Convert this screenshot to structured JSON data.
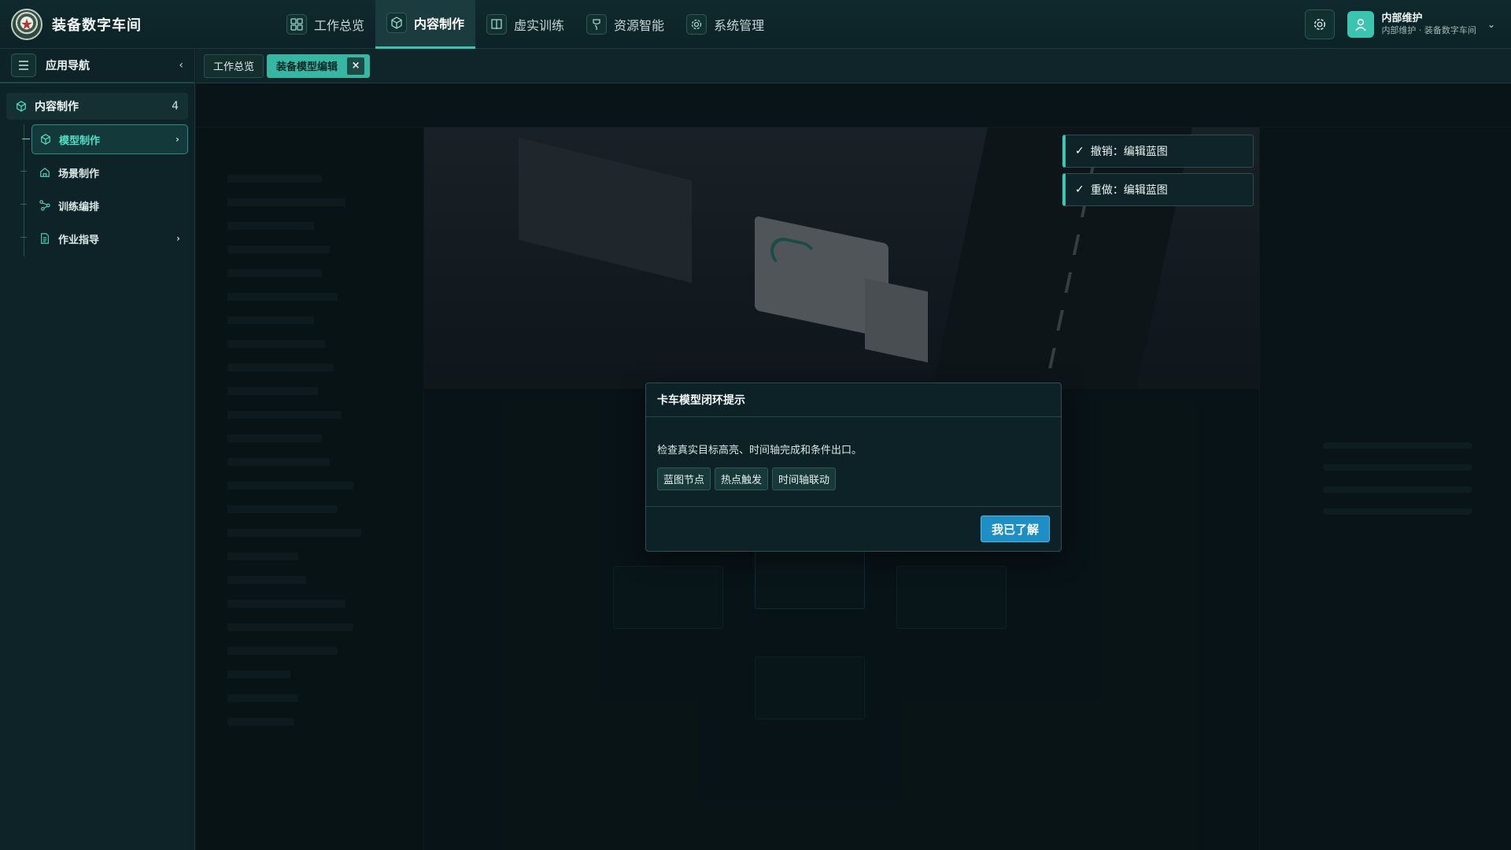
{
  "app": {
    "title": "装备数字车间"
  },
  "nav": [
    {
      "label": "工作总览",
      "icon": "dashboard-grid-icon"
    },
    {
      "label": "内容制作",
      "icon": "cube-icon",
      "active": true
    },
    {
      "label": "虚实训练",
      "icon": "book-icon"
    },
    {
      "label": "资源智能",
      "icon": "plug-icon"
    },
    {
      "label": "系统管理",
      "icon": "gear-icon"
    }
  ],
  "user": {
    "name": "内部维护",
    "sub": "内部维护 · 装备数字车间"
  },
  "sidebar": {
    "title": "应用导航",
    "group": {
      "label": "内容制作",
      "count": "4"
    },
    "items": [
      {
        "label": "模型制作",
        "icon": "cube-icon",
        "active": true,
        "has_children": true
      },
      {
        "label": "场景制作",
        "icon": "home-icon",
        "active": false,
        "has_children": false
      },
      {
        "label": "训练编排",
        "icon": "flow-icon",
        "active": false,
        "has_children": false
      },
      {
        "label": "作业指导",
        "icon": "document-icon",
        "active": false,
        "has_children": true
      }
    ]
  },
  "tabs": [
    {
      "label": "工作总览",
      "active": false
    },
    {
      "label": "装备模型编辑",
      "active": true,
      "close": "×"
    }
  ],
  "toasts": [
    {
      "check": "✓",
      "text": "撤销：编辑蓝图"
    },
    {
      "check": "✓",
      "text": "重做：编辑蓝图"
    }
  ],
  "modal": {
    "title": "卡车模型闭环提示",
    "text": "检查真实目标高亮、时间轴完成和条件出口。",
    "tags": [
      "蓝图节点",
      "热点触发",
      "时间轴联动"
    ],
    "ok_label": "我已了解"
  },
  "colors": {
    "accent": "#35b7a3",
    "primary_button": "#1d8fc4",
    "background": "#0b1a1f"
  }
}
